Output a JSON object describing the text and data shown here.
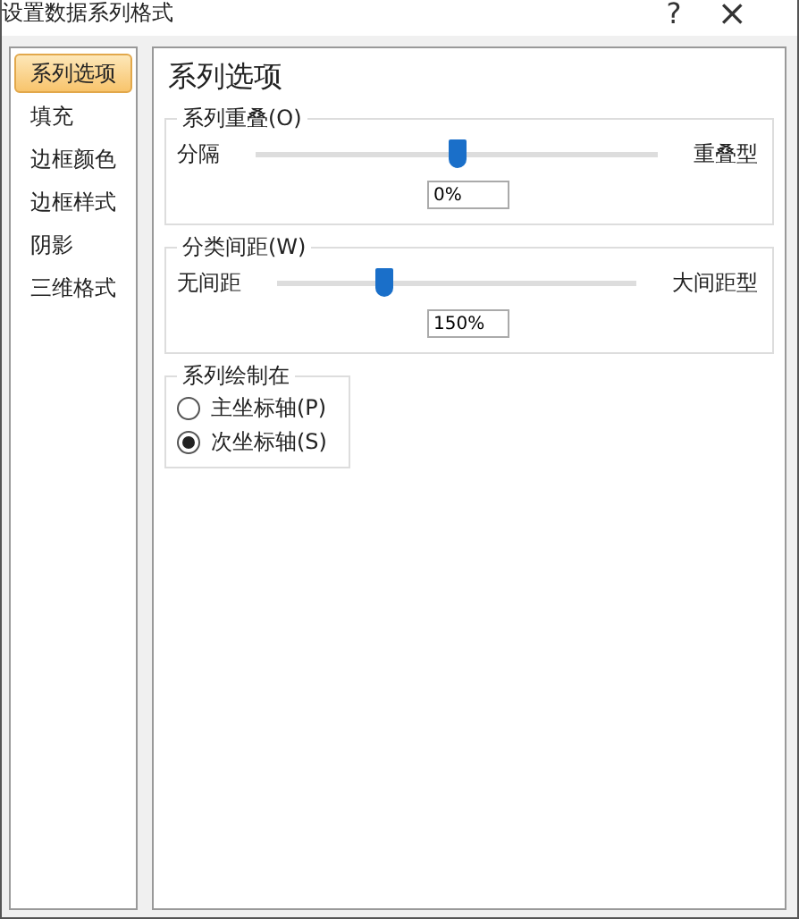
{
  "window": {
    "title": "设置数据系列格式",
    "help": "?",
    "close": "×"
  },
  "sidebar": {
    "items": [
      {
        "label": "系列选项",
        "selected": true
      },
      {
        "label": "填充",
        "selected": false
      },
      {
        "label": "边框颜色",
        "selected": false
      },
      {
        "label": "边框样式",
        "selected": false
      },
      {
        "label": "阴影",
        "selected": false
      },
      {
        "label": "三维格式",
        "selected": false
      }
    ]
  },
  "panel": {
    "title": "系列选项",
    "sliders": [
      {
        "label": "系列重叠(O)",
        "min_label": "分隔",
        "max_label": "重叠型",
        "level": 0.5,
        "value": "0%"
      },
      {
        "label": "分类间距(W)",
        "min_label": "无间距",
        "max_label": "大间距型",
        "level": 0.3,
        "value": "150%"
      }
    ],
    "plot_on": {
      "label": "系列绘制在",
      "options": [
        {
          "label": "主坐标轴(P)",
          "selected": false
        },
        {
          "label": "次坐标轴(S)",
          "selected": true
        }
      ]
    }
  }
}
